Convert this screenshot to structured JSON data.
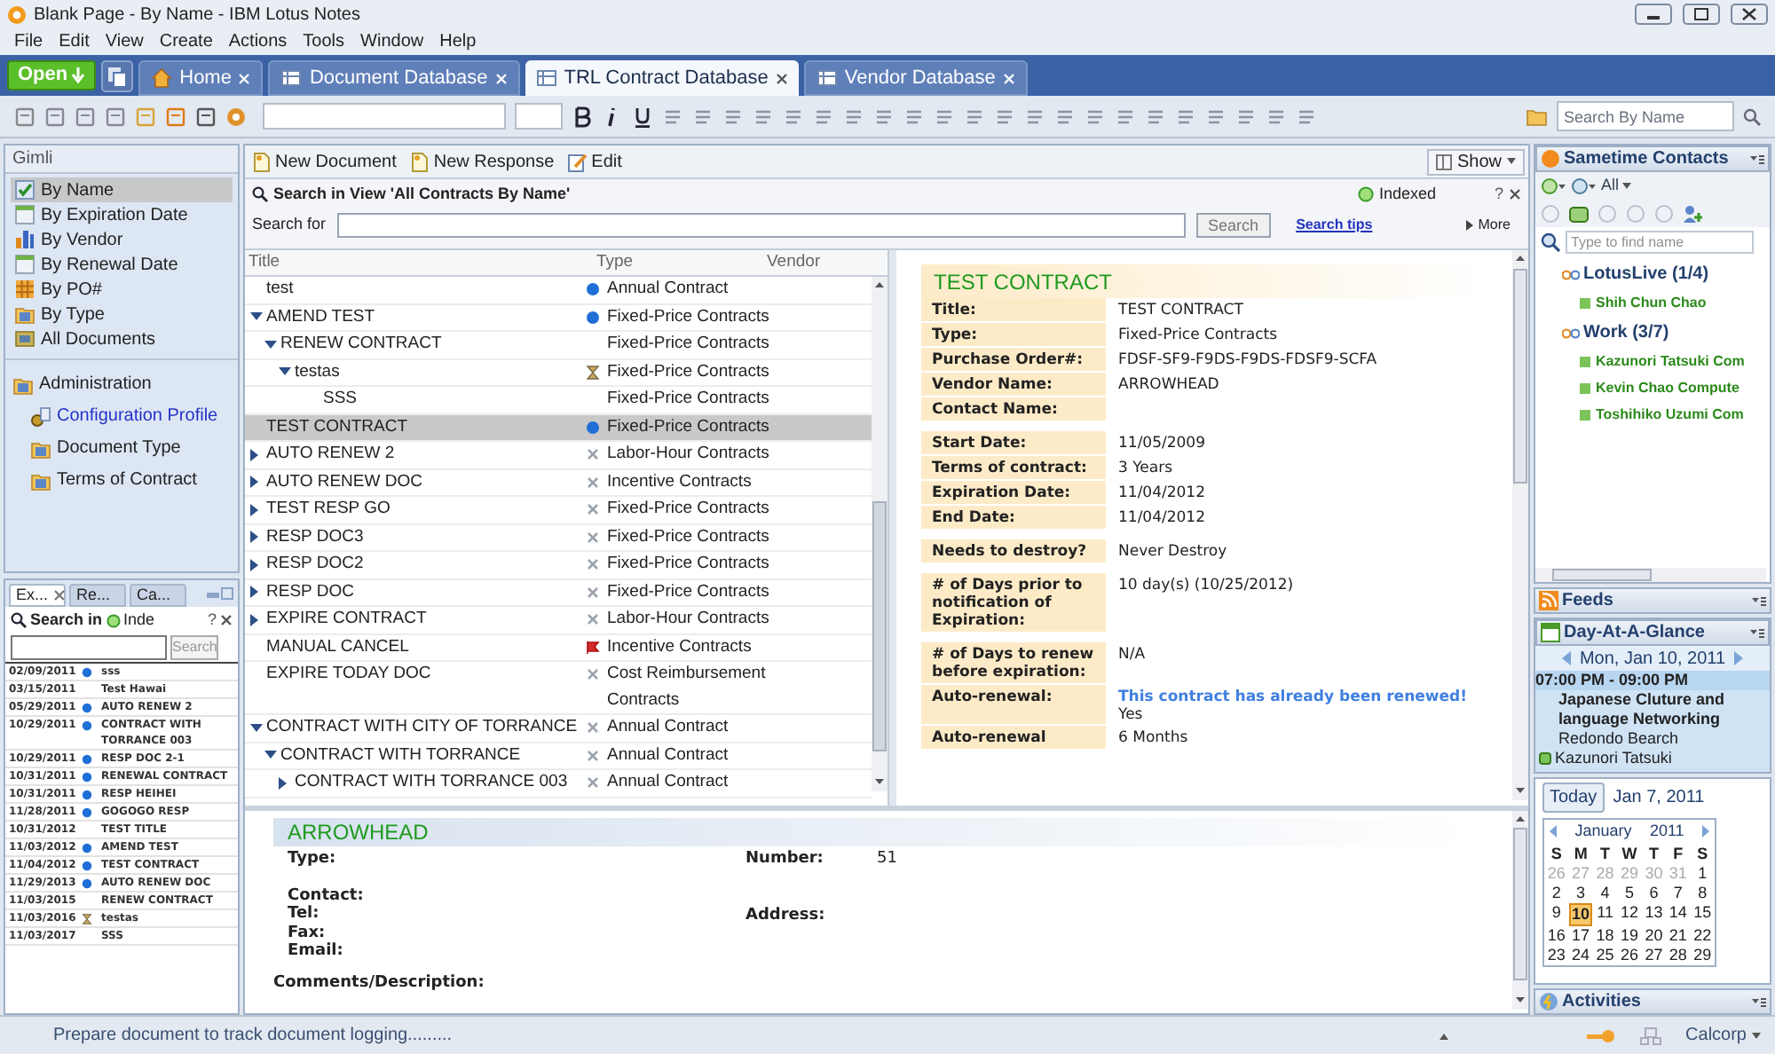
{
  "window": {
    "title": "Blank Page - By Name - IBM Lotus Notes"
  },
  "menu": [
    "File",
    "Edit",
    "View",
    "Create",
    "Actions",
    "Tools",
    "Window",
    "Help"
  ],
  "open_button": "Open",
  "tabs": [
    {
      "label": "Home",
      "selected": false,
      "kind": "home"
    },
    {
      "label": "Document Database",
      "selected": false,
      "kind": "db"
    },
    {
      "label": "TRL Contract Database",
      "selected": true,
      "kind": "db"
    },
    {
      "label": "Vendor Database",
      "selected": false,
      "kind": "db"
    }
  ],
  "toolbar": {
    "search_placeholder": "Search By Name"
  },
  "navigator": {
    "title": "Gimli",
    "views": [
      {
        "label": "By Name",
        "selected": true,
        "kind": "check"
      },
      {
        "label": "By Expiration Date",
        "selected": false,
        "kind": "calendar"
      },
      {
        "label": "By Vendor",
        "selected": false,
        "kind": "chart"
      },
      {
        "label": "By Renewal Date",
        "selected": false,
        "kind": "calendar"
      },
      {
        "label": "By PO#",
        "selected": false,
        "kind": "grid"
      },
      {
        "label": "By Type",
        "selected": false,
        "kind": "folder"
      },
      {
        "label": "All Documents",
        "selected": false,
        "kind": "docs"
      }
    ],
    "folder": {
      "label": "Administration",
      "children": [
        {
          "label": "Configuration Profile",
          "kind": "link"
        },
        {
          "label": "Document Type",
          "kind": "folder"
        },
        {
          "label": "Terms of Contract",
          "kind": "folder"
        }
      ]
    }
  },
  "mini_panel": {
    "tabs": [
      {
        "label": "Ex...",
        "selected": true
      },
      {
        "label": "Re...",
        "selected": false
      },
      {
        "label": "Ca...",
        "selected": false
      }
    ],
    "search_title": "Search in",
    "indexed": "Inde",
    "help": "?",
    "search_button": "Search",
    "rows": [
      {
        "date": "02/09/2011",
        "title": "sss",
        "kind": "dot"
      },
      {
        "date": "03/15/2011",
        "title": "Test Hawai",
        "kind": "none"
      },
      {
        "date": "05/29/2011",
        "title": "AUTO RENEW 2",
        "kind": "dot"
      },
      {
        "date": "10/29/2011",
        "title": "CONTRACT WITH TORRANCE 003",
        "kind": "dot"
      },
      {
        "date": "10/29/2011",
        "title": "RESP DOC 2-1",
        "kind": "dot"
      },
      {
        "date": "10/31/2011",
        "title": "RENEWAL CONTRACT",
        "kind": "dot"
      },
      {
        "date": "10/31/2011",
        "title": "RESP HEIHEI",
        "kind": "dot"
      },
      {
        "date": "11/28/2011",
        "title": "GOGOGO RESP",
        "kind": "dot"
      },
      {
        "date": "10/31/2012",
        "title": "TEST TITLE",
        "kind": "none"
      },
      {
        "date": "11/03/2012",
        "title": "AMEND TEST",
        "kind": "dot"
      },
      {
        "date": "11/04/2012",
        "title": "TEST CONTRACT",
        "kind": "dot"
      },
      {
        "date": "11/29/2013",
        "title": "AUTO RENEW DOC",
        "kind": "dot"
      },
      {
        "date": "11/03/2015",
        "title": "RENEW CONTRACT",
        "kind": "none"
      },
      {
        "date": "11/03/2016",
        "title": "testas",
        "kind": "hourglass"
      },
      {
        "date": "11/03/2017",
        "title": "SSS",
        "kind": "none"
      }
    ]
  },
  "actions": [
    "New Document",
    "New Response",
    "Edit"
  ],
  "show_button": "Show",
  "search": {
    "title": "Search in View 'All Contracts By Name'",
    "indexed": "Indexed",
    "help": "?",
    "label": "Search for",
    "button": "Search",
    "tips": "Search tips",
    "more": "More"
  },
  "columns": [
    "Title",
    "Type",
    "Vendor"
  ],
  "rows": [
    {
      "title": "test",
      "type": "Annual Contract",
      "kind": "dot",
      "selected": false
    },
    {
      "title": "AMEND TEST",
      "type": "Fixed-Price Contracts",
      "kind": "dot",
      "expanded": true,
      "selected": false,
      "children": [
        {
          "title": "RENEW CONTRACT",
          "type": "Fixed-Price Contracts",
          "expanded": true,
          "selected": false,
          "children": [
            {
              "title": "testas",
              "type": "Fixed-Price Contracts",
              "kind": "hourglass",
              "expanded": true,
              "selected": false,
              "children": [
                {
                  "title": "SSS",
                  "type": "Fixed-Price Contracts",
                  "selected": false
                }
              ]
            }
          ]
        }
      ]
    },
    {
      "title": "TEST CONTRACT",
      "type": "Fixed-Price Contracts",
      "kind": "dot",
      "selected": true
    },
    {
      "title": "AUTO RENEW 2",
      "type": "Labor-Hour Contracts",
      "kind": "x",
      "expanded": false,
      "selected": false
    },
    {
      "title": "AUTO RENEW DOC",
      "type": "Incentive Contracts",
      "kind": "x",
      "expanded": false,
      "selected": false
    },
    {
      "title": "TEST RESP GO",
      "type": "Fixed-Price Contracts",
      "kind": "x",
      "expanded": false,
      "selected": false
    },
    {
      "title": "RESP DOC3",
      "type": "Fixed-Price Contracts",
      "kind": "x",
      "expanded": false,
      "selected": false
    },
    {
      "title": "RESP DOC2",
      "type": "Fixed-Price Contracts",
      "kind": "x",
      "expanded": false,
      "selected": false
    },
    {
      "title": "RESP DOC",
      "type": "Fixed-Price Contracts",
      "kind": "x",
      "expanded": false,
      "selected": false
    },
    {
      "title": "EXPIRE CONTRACT",
      "type": "Labor-Hour Contracts",
      "kind": "x",
      "expanded": false,
      "selected": false
    },
    {
      "title": "MANUAL CANCEL",
      "type": "Incentive Contracts",
      "kind": "flag",
      "selected": false
    },
    {
      "title": "EXPIRE TODAY DOC",
      "type": "Cost Reimbursement Contracts",
      "kind": "x",
      "selected": false
    },
    {
      "title": "CONTRACT WITH CITY OF TORRANCE",
      "type": "Annual Contract",
      "kind": "x",
      "expanded": true,
      "selected": false,
      "children": [
        {
          "title": "CONTRACT WITH TORRANCE",
          "type": "Annual Contract",
          "kind": "x",
          "expanded": true,
          "selected": false,
          "children": [
            {
              "title": "CONTRACT WITH TORRANCE 003",
              "type": "Annual Contract",
              "kind": "x",
              "expanded": false,
              "selected": false
            }
          ]
        }
      ]
    }
  ],
  "document": {
    "heading": "TEST CONTRACT",
    "groups": [
      [
        {
          "label": "Title:",
          "value": "TEST CONTRACT"
        },
        {
          "label": "Type:",
          "value": "Fixed-Price Contracts"
        },
        {
          "label": "Purchase Order#:",
          "value": "FDSF-SF9-F9DS-F9DS-FDSF9-SCFA"
        },
        {
          "label": "Vendor Name:",
          "value": "ARROWHEAD"
        },
        {
          "label": "Contact Name:"
        }
      ],
      [
        {
          "label": "Start Date:",
          "value": "11/05/2009"
        },
        {
          "label": "Terms of contract:",
          "value": "3 Years"
        },
        {
          "label": "Expiration Date:",
          "value": "11/04/2012"
        },
        {
          "label": "End Date:",
          "value": "11/04/2012"
        }
      ],
      [
        {
          "label": "Needs to destroy?",
          "value": "Never Destroy"
        }
      ],
      [
        {
          "label": "# of Days prior to notification of Expiration:",
          "value": "10 day(s)  (10/25/2012)"
        }
      ],
      [
        {
          "label": "# of Days to renew before expiration:",
          "value": "N/A"
        },
        {
          "label": "Auto-renewal:",
          "notice": "This contract has already been renewed!",
          "value": "Yes"
        },
        {
          "label": "Auto-renewal",
          "value": "6 Months"
        }
      ]
    ]
  },
  "vendor": {
    "heading": "ARROWHEAD",
    "left": [
      "Type:",
      "Contact:",
      "Tel:",
      "Fax:",
      "Email:"
    ],
    "right": [
      {
        "label": "Number:",
        "value": "51"
      },
      {
        "label": "Address:"
      }
    ],
    "comments": "Comments/Description:"
  },
  "sametime": {
    "title": "Sametime Contacts",
    "filter": "All",
    "placeholder": "Type to find name",
    "groups": [
      {
        "name": "LotusLive (1/4)",
        "contacts": [
          "Shih Chun Chao"
        ]
      },
      {
        "name": "Work (3/7)",
        "contacts": [
          "Kazunori Tatsuki Com",
          "Kevin Chao Compute",
          "Toshihiko Uzumi Com"
        ]
      }
    ]
  },
  "feeds": {
    "title": "Feeds"
  },
  "day_at_a_glance": {
    "title": "Day-At-A-Glance",
    "date": "Mon, Jan 10, 2011",
    "time": "07:00 PM - 09:00 PM",
    "event": "Japanese Cluture and language Networking",
    "location": "Redondo Bearch",
    "person": "Kazunori Tatsuki"
  },
  "calendar": {
    "today_button": "Today",
    "date": "Jan 7, 2011",
    "month": "January",
    "year": "2011",
    "weekdays": [
      "S",
      "M",
      "T",
      "W",
      "T",
      "F",
      "S"
    ],
    "weeks": [
      [
        {
          "d": "26",
          "muted": true,
          "selected": false
        },
        {
          "d": "27",
          "muted": true,
          "selected": false
        },
        {
          "d": "28",
          "muted": true,
          "selected": false
        },
        {
          "d": "29",
          "muted": true,
          "selected": false
        },
        {
          "d": "30",
          "muted": true,
          "selected": false
        },
        {
          "d": "31",
          "muted": true,
          "selected": false
        },
        {
          "d": "1",
          "muted": false,
          "selected": false
        }
      ],
      [
        {
          "d": "2",
          "muted": false,
          "selected": false
        },
        {
          "d": "3",
          "muted": false,
          "selected": false
        },
        {
          "d": "4",
          "muted": false,
          "selected": false
        },
        {
          "d": "5",
          "muted": false,
          "selected": false
        },
        {
          "d": "6",
          "muted": false,
          "selected": false
        },
        {
          "d": "7",
          "muted": false,
          "selected": false
        },
        {
          "d": "8",
          "muted": false,
          "selected": false
        }
      ],
      [
        {
          "d": "9",
          "muted": false,
          "selected": false
        },
        {
          "d": "10",
          "muted": false,
          "selected": true
        },
        {
          "d": "11",
          "muted": false,
          "selected": false
        },
        {
          "d": "12",
          "muted": false,
          "selected": false
        },
        {
          "d": "13",
          "muted": false,
          "selected": false
        },
        {
          "d": "14",
          "muted": false,
          "selected": false
        },
        {
          "d": "15",
          "muted": false,
          "selected": false
        }
      ],
      [
        {
          "d": "16",
          "muted": false,
          "selected": false
        },
        {
          "d": "17",
          "muted": false,
          "selected": false
        },
        {
          "d": "18",
          "muted": false,
          "selected": false
        },
        {
          "d": "19",
          "muted": false,
          "selected": false
        },
        {
          "d": "20",
          "muted": false,
          "selected": false
        },
        {
          "d": "21",
          "muted": false,
          "selected": false
        },
        {
          "d": "22",
          "muted": false,
          "selected": false
        }
      ],
      [
        {
          "d": "23",
          "muted": false,
          "selected": false
        },
        {
          "d": "24",
          "muted": false,
          "selected": false
        },
        {
          "d": "25",
          "muted": false,
          "selected": false
        },
        {
          "d": "26",
          "muted": false,
          "selected": false
        },
        {
          "d": "27",
          "muted": false,
          "selected": false
        },
        {
          "d": "28",
          "muted": false,
          "selected": false
        },
        {
          "d": "29",
          "muted": false,
          "selected": false
        }
      ]
    ]
  },
  "activities": {
    "title": "Activities"
  },
  "status_bar": {
    "message": "Prepare document to track document logging.........",
    "location": "Calcorp"
  }
}
